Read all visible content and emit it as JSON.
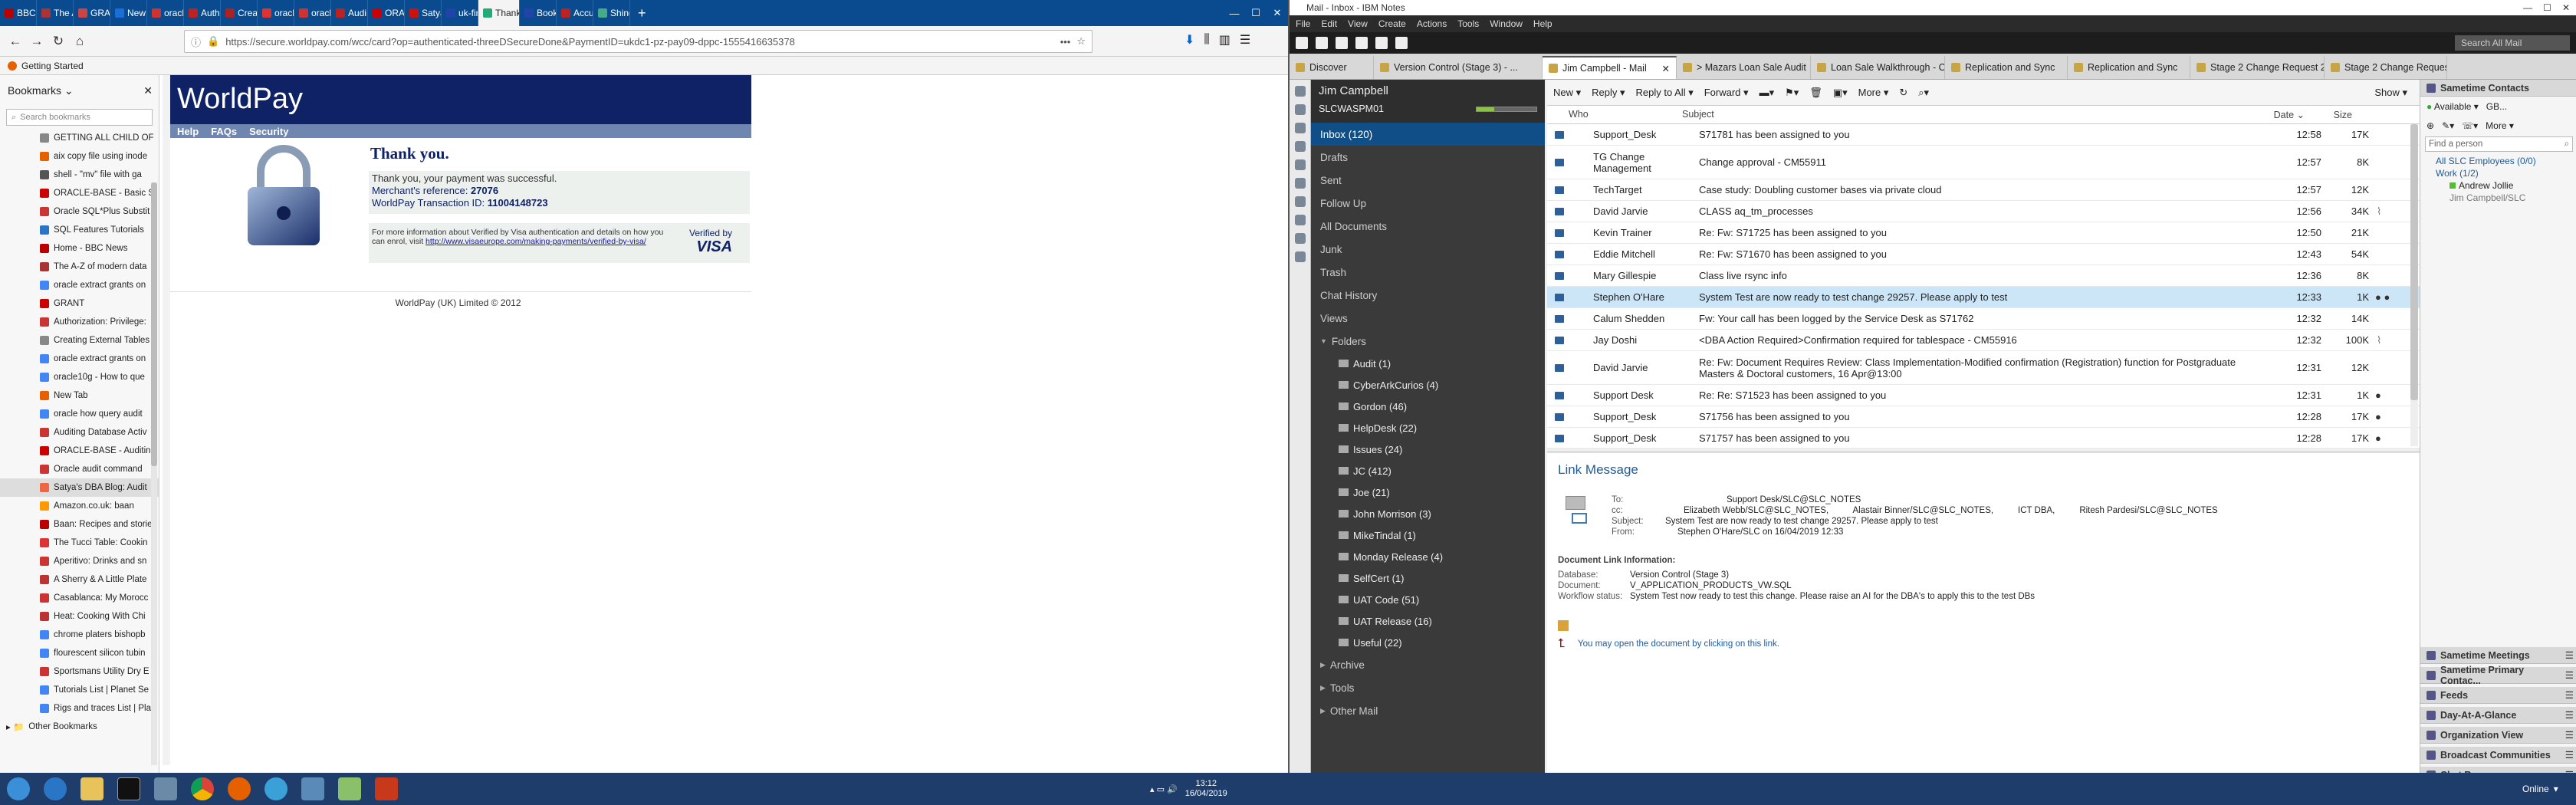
{
  "browser": {
    "tabs": [
      "BBC N",
      "The A",
      "GRAN",
      "New",
      "oracle",
      "Authe",
      "Creat",
      "oracle",
      "oracle",
      "Audi",
      "ORAC",
      "Satya",
      "uk-fin",
      "Thank",
      "Book",
      "Accu",
      "Shine"
    ],
    "active_tab": "Thank",
    "url": "https://secure.worldpay.com/wcc/card?op=authenticated-threeDSecureDone&PaymentID=ukdc1-pz-pay09-dppc-1555416635378",
    "bookmarks_bar": "Getting Started",
    "sidebar_title": "Bookmarks",
    "sidebar_search": "Search bookmarks",
    "bookmarks": [
      "GETTING ALL CHILD OF",
      "aix copy file using inode",
      "shell - \"mv\" file with ga",
      "ORACLE-BASE - Basic S",
      "Oracle SQL*Plus Substit",
      "SQL Features Tutorials",
      "Home - BBC News",
      "The A-Z of modern data",
      "oracle extract grants on",
      "GRANT",
      "Authorization: Privilege:",
      "Creating External Tables",
      "oracle extract grants on",
      "oracle10g - How to que",
      "New Tab",
      "oracle how query audit",
      "Auditing Database Activ",
      "ORACLE-BASE - Auditin",
      "Oracle audit command",
      "Satya's DBA Blog: Audit",
      "Amazon.co.uk: baan",
      "Baan: Recipes and storie",
      "The Tucci Table: Cookin",
      "Aperitivo: Drinks and sn",
      "A Sherry & A Little Plate",
      "Casablanca: My Morocc",
      "Heat: Cooking With Chi",
      "chrome platers bishopb",
      "flourescent silicon tubin",
      "Sportsmans Utility Dry E",
      "Tutorials List | Planet Se",
      "Rigs and traces List | Pla"
    ],
    "other_bookmarks": "Other Bookmarks"
  },
  "worldpay": {
    "logo": "WorldPay",
    "nav": [
      "Help",
      "FAQs",
      "Security"
    ],
    "title": "Thank you.",
    "line1": "Thank you, your payment was successful.",
    "merchant_label": "Merchant's reference:",
    "merchant_value": "27076",
    "txn_label": "WorldPay Transaction ID:",
    "txn_value": "11004148723",
    "info": "For more information about Verified by Visa authentication and details on how you can enrol, visit",
    "link": "http://www.visaeurope.com/making-payments/verified-by-visa/",
    "verified": "Verified by",
    "visa": "VISA",
    "footer": "WorldPay (UK) Limited © 2012"
  },
  "notes": {
    "title": "Mail - Inbox - IBM Notes",
    "menu": [
      "File",
      "Edit",
      "View",
      "Create",
      "Actions",
      "Tools",
      "Window",
      "Help"
    ],
    "search": "Search All Mail",
    "tabs": [
      "Discover",
      "Version Control (Stage 3) - ...",
      "Jim Campbell - Mail",
      "> Mazars Loan Sale Audit",
      "Loan Sale Walkthrough - C...",
      "Replication and Sync",
      "Replication and Sync",
      "Stage 2 Change Request 29...",
      "Stage 2 Change Request 29..."
    ],
    "user": "Jim Campbell",
    "server": "SLCWASPM01",
    "nav": [
      "Inbox (120)",
      "Drafts",
      "Sent",
      "Follow Up",
      "All Documents",
      "Junk",
      "Trash",
      "Chat History",
      "Views",
      "Folders"
    ],
    "folders": [
      "Audit (1)",
      "CyberArkCurios (4)",
      "Gordon (46)",
      "HelpDesk (22)",
      "Issues (24)",
      "JC (412)",
      "Joe (21)",
      "John Morrison (3)",
      "MikeTindal (1)",
      "Monday Release (4)",
      "SelfCert (1)",
      "UAT Code (51)",
      "UAT Release (16)",
      "Useful (22)"
    ],
    "nav_tail": [
      "Archive",
      "Tools",
      "Other Mail"
    ],
    "toolbar": [
      "New",
      "Reply",
      "Reply to All",
      "Forward",
      "More",
      "Show"
    ],
    "cols": {
      "who": "Who",
      "subject": "Subject",
      "date": "Date",
      "size": "Size"
    },
    "rows": [
      {
        "who": "Support_Desk",
        "sub": "S71781 has been assigned to you",
        "date": "12:58",
        "size": "17K"
      },
      {
        "who": "TG Change Management",
        "sub": "Change approval - CM55911",
        "date": "12:57",
        "size": "8K"
      },
      {
        "who": "TechTarget",
        "sub": "Case study: Doubling customer bases via private cloud",
        "date": "12:57",
        "size": "12K"
      },
      {
        "who": "David Jarvie",
        "sub": "CLASS aq_tm_processes",
        "date": "12:56",
        "size": "34K"
      },
      {
        "who": "Kevin Trainer",
        "sub": "Re: Fw: S71725 has been assigned to you",
        "date": "12:50",
        "size": "21K"
      },
      {
        "who": "Eddie Mitchell",
        "sub": "Re: Fw: S71670 has been assigned to you",
        "date": "12:43",
        "size": "54K"
      },
      {
        "who": "Mary Gillespie",
        "sub": "Class live rsync info",
        "date": "12:36",
        "size": "8K"
      },
      {
        "who": "Stephen O'Hare",
        "sub": "System Test are now ready to test change 29257. Please apply to test",
        "date": "12:33",
        "size": "1K"
      },
      {
        "who": "Calum Shedden",
        "sub": "Fw: Your call has been logged by the Service Desk as S71762",
        "date": "12:32",
        "size": "14K"
      },
      {
        "who": "Jay Doshi",
        "sub": "<DBA Action Required>Confirmation required for tablespace - CM55916",
        "date": "12:32",
        "size": "100K"
      },
      {
        "who": "David Jarvie",
        "sub": "Re: Fw: Document Requires Review:  Class Implementation-Modified confirmation (Registration) function for Postgraduate Masters & Doctoral customers, 16 Apr@13:00",
        "date": "12:31",
        "size": "12K"
      },
      {
        "who": "Support Desk",
        "sub": "Re: Re: S71523 has been assigned to you",
        "date": "12:31",
        "size": "1K"
      },
      {
        "who": "Support_Desk",
        "sub": "S71756 has been assigned to you",
        "date": "12:28",
        "size": "17K"
      },
      {
        "who": "Support_Desk",
        "sub": "S71757 has been assigned to you",
        "date": "12:28",
        "size": "17K"
      }
    ],
    "preview": {
      "title": "Link Message",
      "to_label": "To:",
      "to": "Support Desk/SLC@SLC_NOTES",
      "cc_label": "cc:",
      "cc": "Elizabeth Webb/SLC@SLC_NOTES,          Alastair Binner/SLC@SLC_NOTES,          ICT DBA,          Ritesh Pardesi/SLC@SLC_NOTES",
      "subject_label": "Subject:",
      "subject": "System Test are now ready to test change 29257. Please apply to test",
      "from_label": "From:",
      "from": "Stephen O'Hare/SLC on 16/04/2019 12:33",
      "doclink": "Document Link Information:",
      "db_label": "Database:",
      "db": "Version Control (Stage 3)",
      "doc_label": "Document:",
      "doc": "V_APPLICATION_PRODUCTS_VW.SQL",
      "wf_label": "Workflow status:",
      "wf": "System Test now ready to test this change. Please raise an AI for the DBA's to apply this to the test DBs",
      "open": "You may open the document by clicking on this link."
    },
    "right": {
      "contacts": "Sametime Contacts",
      "status": "Available",
      "gb": "GB...",
      "more": "More",
      "find": "Find a person",
      "group1": "All SLC Employees (0/0)",
      "group2": "Work (1/2)",
      "c1": "Andrew Jollie",
      "c2": "Jim Campbell/SLC",
      "panels": [
        "Sametime Meetings",
        "Sametime Primary Contac...",
        "Feeds",
        "Day-At-A-Glance",
        "Organization View",
        "Broadcast Communities",
        "Chat Rooms"
      ]
    },
    "status_online": "Online"
  },
  "clock": {
    "time": "13:12",
    "date": "16/04/2019"
  }
}
